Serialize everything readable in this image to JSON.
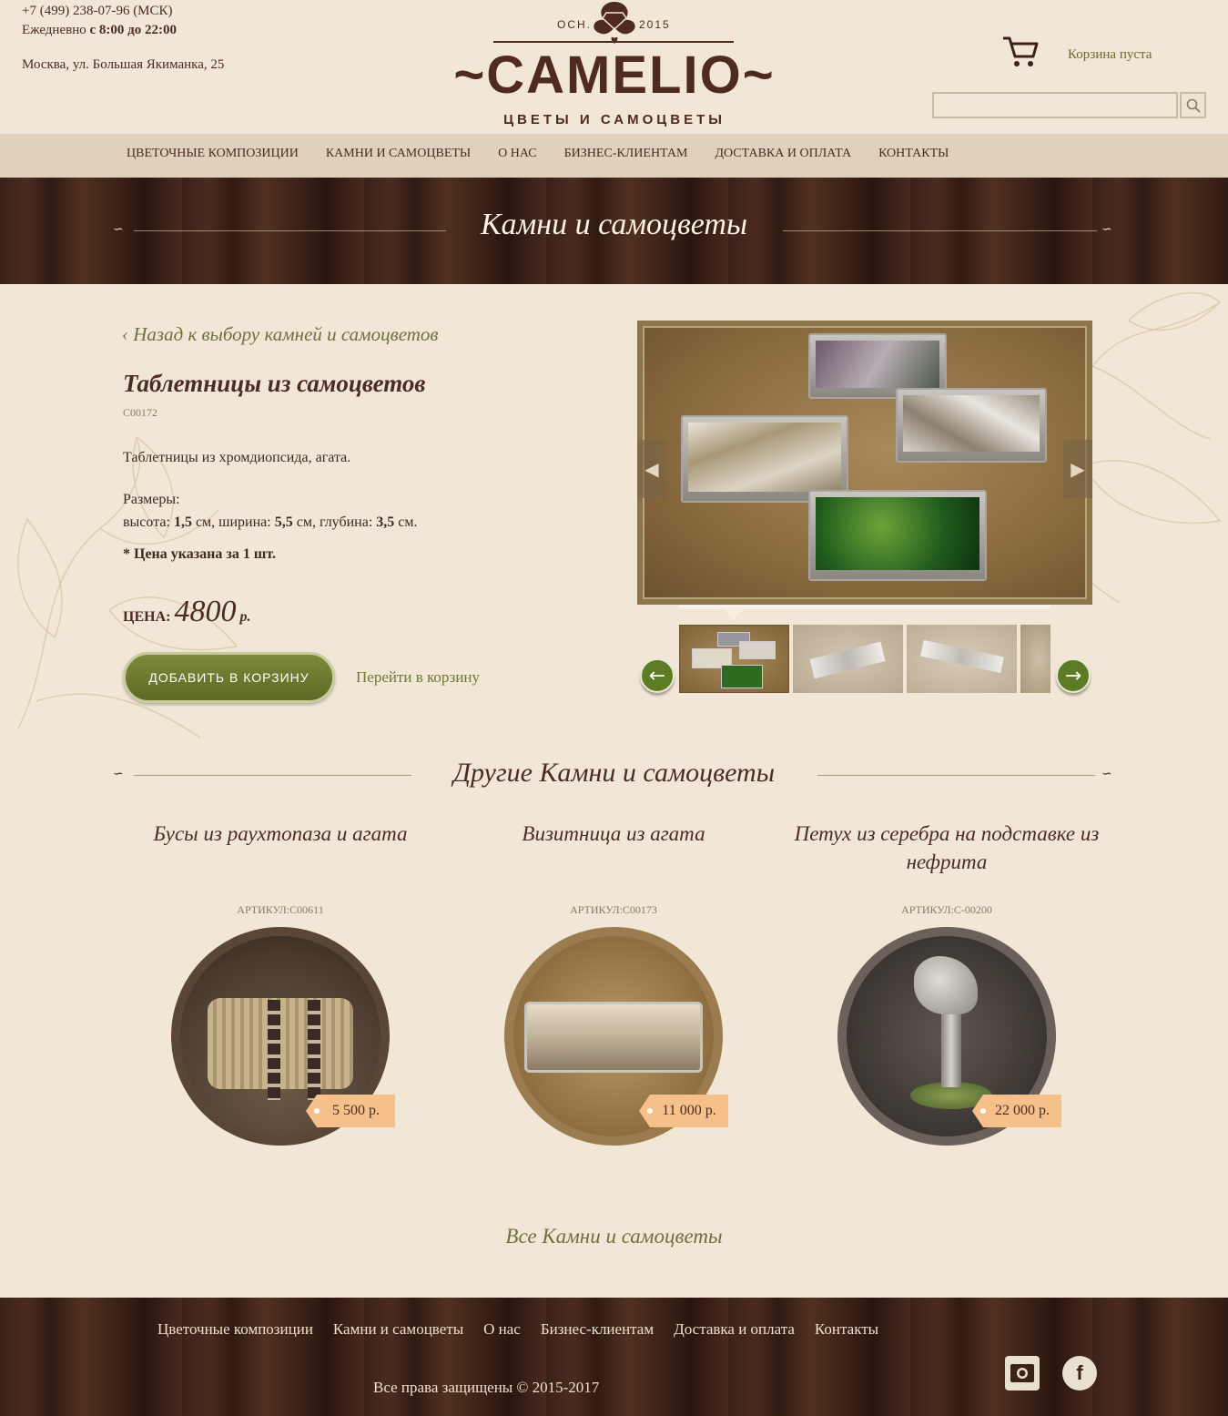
{
  "header": {
    "phone": "+7 (499) 238-07-96 (МСК)",
    "hours_prefix": "Ежедневно ",
    "hours_bold": "с 8:00 до 22:00",
    "address": "Москва, ул. Большая Якиманка, 25",
    "logo_est_left": "ОСН.",
    "logo_est_right": "2015",
    "logo_name": "~CAMELIO~",
    "logo_sub": "ЦВЕТЫ И САМОЦВЕТЫ",
    "cart_text": "Корзина пуста",
    "search_placeholder": ""
  },
  "nav": {
    "items": [
      "ЦВЕТОЧНЫЕ КОМПОЗИЦИИ",
      "КАМНИ И САМОЦВЕТЫ",
      "О НАС",
      "БИЗНЕС-КЛИЕНТАМ",
      "ДОСТАВКА И ОПЛАТА",
      "КОНТАКТЫ"
    ]
  },
  "banner": {
    "title": "Камни и самоцветы"
  },
  "product": {
    "back_link": "‹ Назад к выбору камней и самоцветов",
    "title": "Таблетницы из самоцветов",
    "sku": "С00172",
    "description": "Таблетницы из хромдиопсида, агата.",
    "sizes_label": "Размеры:",
    "height_label": "высота: ",
    "height_value": "1,5",
    "width_label": " см, ширина: ",
    "width_value": "5,5",
    "depth_label": " см, глубина: ",
    "depth_value": "3,5",
    "unit": " см.",
    "note": "* Цена указана за 1 шт.",
    "price_label": "ЦЕНА: ",
    "price_value": "4800",
    "price_currency": "р.",
    "add_to_cart": "ДОБАВИТЬ В КОРЗИНУ",
    "go_to_cart": "Перейти в корзину"
  },
  "other": {
    "title": "Другие Камни и самоцветы",
    "items": [
      {
        "name": "Бусы из раухтопаза и агата",
        "article": "АРТИКУЛ:С00611",
        "price": "5 500 р."
      },
      {
        "name": "Визитница из агата",
        "article": "АРТИКУЛ:С00173",
        "price": "11 000 р."
      },
      {
        "name": "Петух из серебра на подставке из нефрита",
        "article": "АРТИКУЛ:С-00200",
        "price": "22 000 р."
      }
    ],
    "all_link": "Все Камни и самоцветы"
  },
  "footer": {
    "items": [
      "Цветочные композиции",
      "Камни и самоцветы",
      "О нас",
      "Бизнес-клиентам",
      "Доставка и оплата",
      "Контакты"
    ],
    "copyright": "Все права защищены © 2015-2017",
    "social": [
      "instagram-icon",
      "facebook-icon"
    ],
    "facebook_glyph": "f"
  },
  "colors": {
    "accent_green": "#5d7a25",
    "brand_brown": "#4f2a1f",
    "background": "#f2e6d6",
    "price_tag": "#f6c08a"
  }
}
